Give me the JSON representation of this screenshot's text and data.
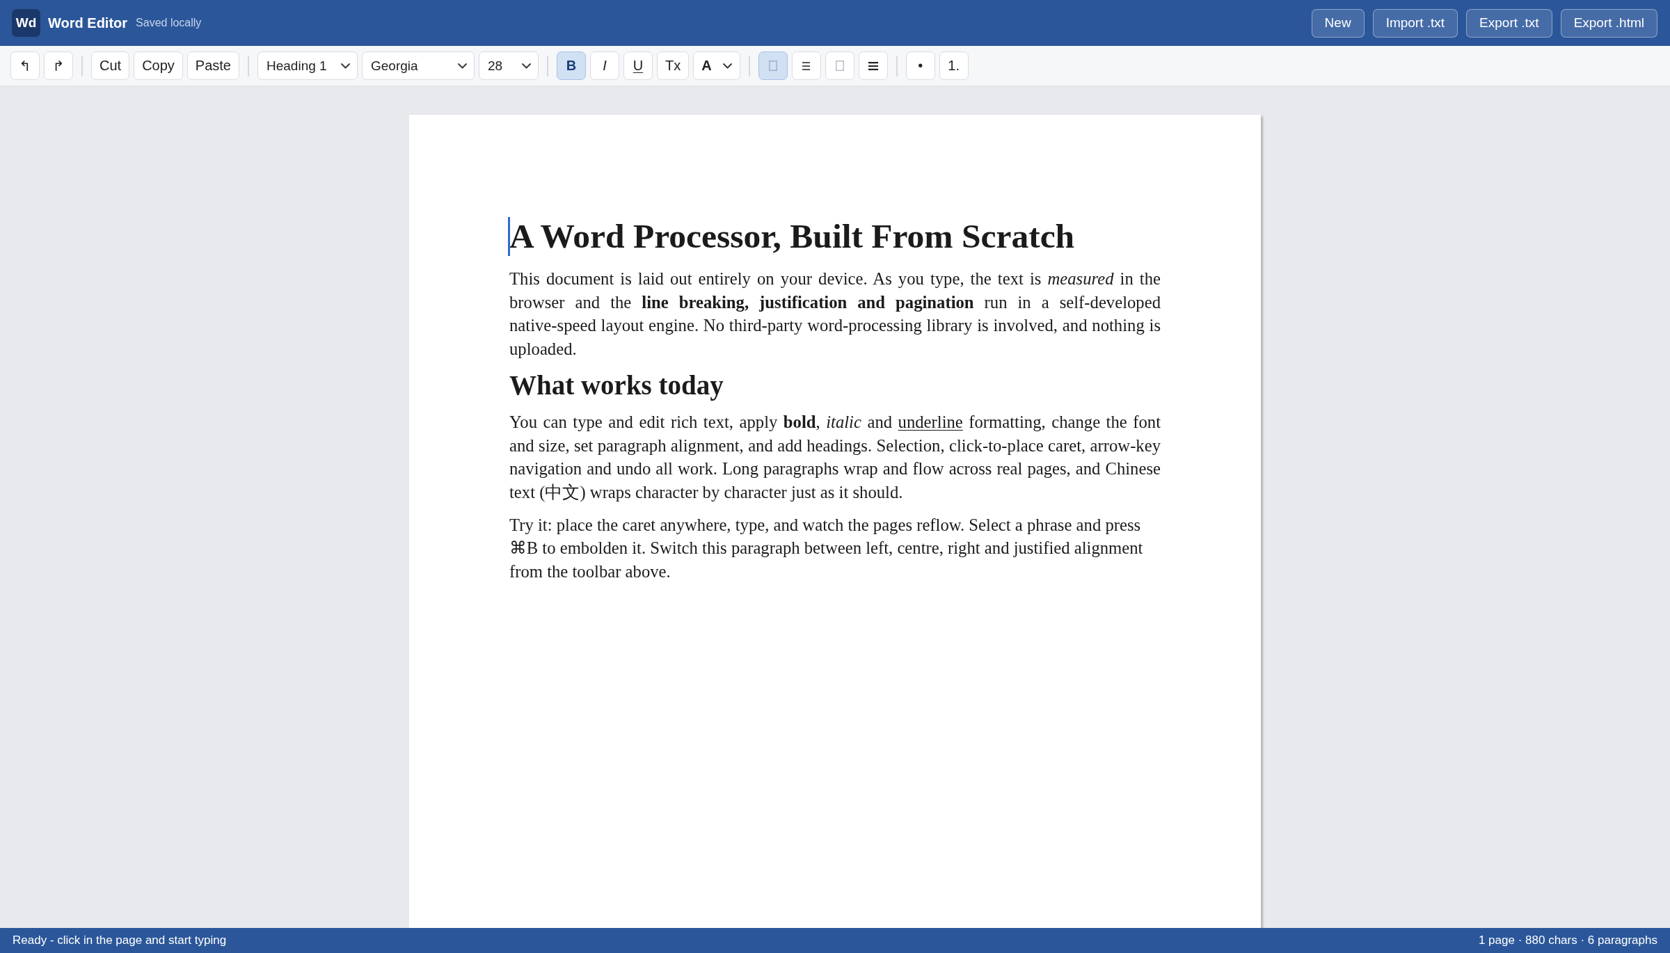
{
  "app": {
    "logo": "Wd",
    "title": "Word Editor",
    "save_status": "Saved locally"
  },
  "header_buttons": [
    {
      "label": "New"
    },
    {
      "label": "Import .txt"
    },
    {
      "label": "Export .txt"
    },
    {
      "label": "Export .html"
    }
  ],
  "toolbar": {
    "history": [
      {
        "label": "↰"
      },
      {
        "label": "↱"
      }
    ],
    "clipboard": [
      {
        "label": "Cut"
      },
      {
        "label": "Copy"
      },
      {
        "label": "Paste"
      }
    ],
    "selects": [
      {
        "value": "Heading 1"
      },
      {
        "value": "Georgia"
      },
      {
        "value": "28"
      }
    ],
    "format": [
      {
        "kind": "bold",
        "label": "B",
        "on": true
      },
      {
        "kind": "italic",
        "label": "I",
        "on": false
      },
      {
        "kind": "underline",
        "label": "U",
        "on": false
      },
      {
        "kind": "clear",
        "label": "Tx"
      },
      {
        "kind": "color",
        "label": "A"
      }
    ],
    "alignment": [
      {
        "kind": "left",
        "selected": true
      },
      {
        "kind": "center",
        "selected": false
      },
      {
        "kind": "right",
        "selected": false
      },
      {
        "kind": "justify",
        "selected": false
      }
    ],
    "lists": [
      {
        "label": "•"
      },
      {
        "label": "1."
      }
    ]
  },
  "document": {
    "blocks": [
      {
        "kind": "heading1",
        "justified": false,
        "caret": true,
        "runs": [
          {
            "text": "A Word Processor, Built From Scratch",
            "kind": "plain"
          }
        ]
      },
      {
        "kind": "paragraph",
        "justified": true,
        "caret": false,
        "runs": [
          {
            "text": "This document is laid out entirely on your device. As you type, the text is ",
            "kind": "plain"
          },
          {
            "text": "measured",
            "kind": "italic"
          },
          {
            "text": " in the browser and the ",
            "kind": "plain"
          },
          {
            "text": "line breaking, justification and pagination",
            "kind": "bold"
          },
          {
            "text": " run in a self-developed native-speed layout engine. No third-party word-processing library is involved, and nothing is uploaded.",
            "kind": "plain"
          }
        ]
      },
      {
        "kind": "heading2",
        "justified": false,
        "caret": false,
        "runs": [
          {
            "text": "What works today",
            "kind": "plain"
          }
        ]
      },
      {
        "kind": "paragraph",
        "justified": true,
        "caret": false,
        "runs": [
          {
            "text": "You can type and edit rich text, apply ",
            "kind": "plain"
          },
          {
            "text": "bold",
            "kind": "bold"
          },
          {
            "text": ", ",
            "kind": "plain"
          },
          {
            "text": "italic",
            "kind": "italic"
          },
          {
            "text": " and ",
            "kind": "plain"
          },
          {
            "text": "underline",
            "kind": "underline"
          },
          {
            "text": " formatting, change the font and size, set paragraph alignment, and add headings. Selection, click-to-place caret, arrow-key navigation and undo all work. Long paragraphs wrap and flow across real pages, and Chinese text (中文) wraps character by character just as it should.",
            "kind": "plain"
          }
        ]
      },
      {
        "kind": "paragraph",
        "justified": false,
        "caret": false,
        "runs": [
          {
            "text": "Try it: place the caret anywhere, type, and watch the pages reflow. Select a phrase and press ⌘B to embolden it. Switch this paragraph between left, centre, right and justified alignment from the toolbar above.",
            "kind": "plain"
          }
        ]
      }
    ]
  },
  "status_bar": {
    "message": "Ready - click in the page and start typing",
    "stats": "1 page · 880 chars · 6 paragraphs"
  }
}
